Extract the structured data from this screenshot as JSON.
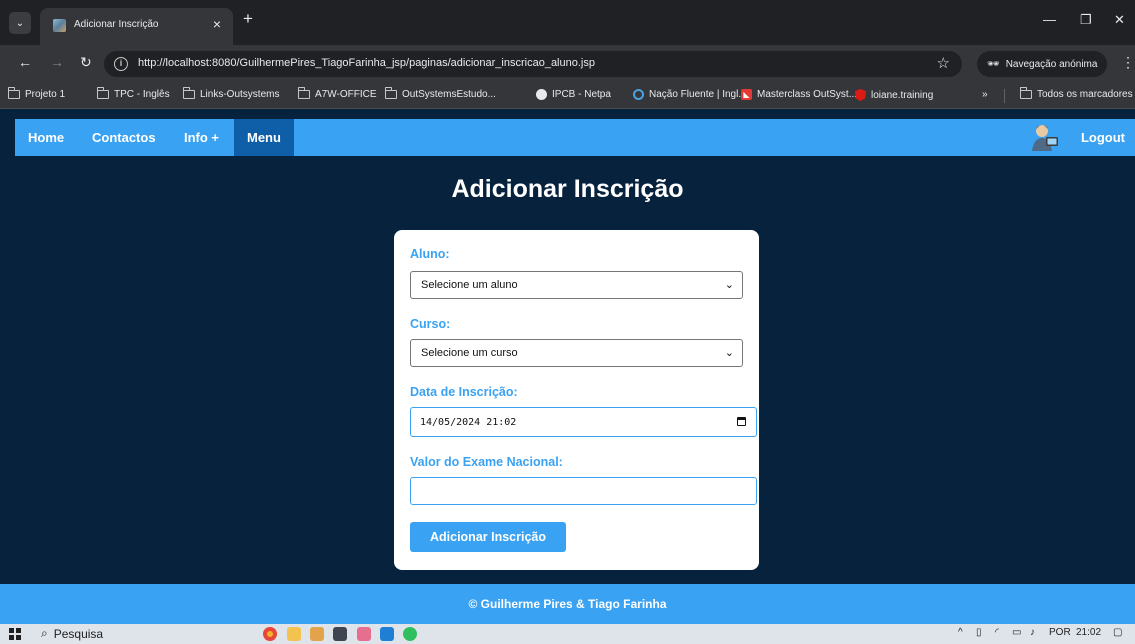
{
  "browser": {
    "tab_title": "Adicionar Inscrição",
    "url": "http://localhost:8080/GuilhermePires_TiagoFarinha_jsp/paginas/adicionar_inscricao_aluno.jsp",
    "incognito_label": "Navegação anónima",
    "bookmarks": [
      {
        "label": "Projeto 1",
        "icon": "folder-icon"
      },
      {
        "label": "TPC - Inglês",
        "icon": "folder-icon"
      },
      {
        "label": "Links-Outsystems",
        "icon": "folder-icon"
      },
      {
        "label": "A7W-OFFICE",
        "icon": "folder-icon"
      },
      {
        "label": "OutSystemsEstudo...",
        "icon": "folder-icon"
      },
      {
        "label": "IPCB - Netpa",
        "icon": "globe-icon"
      },
      {
        "label": "Nação Fluente | Ingl...",
        "icon": "ring-icon"
      },
      {
        "label": "Masterclass OutSyst...",
        "icon": "red-icon"
      },
      {
        "label": "loiane.training",
        "icon": "angular-icon"
      }
    ],
    "all_bookmarks_label": "Todos os marcadores"
  },
  "navbar": {
    "items": [
      {
        "label": "Home"
      },
      {
        "label": "Contactos"
      },
      {
        "label": "Info +"
      },
      {
        "label": "Menu"
      }
    ],
    "active": "Menu",
    "logout_label": "Logout"
  },
  "page": {
    "title": "Adicionar Inscrição"
  },
  "form": {
    "aluno_label": "Aluno:",
    "aluno_selected": "Selecione um aluno",
    "curso_label": "Curso:",
    "curso_selected": "Selecione um curso",
    "data_label": "Data de Inscrição:",
    "data_value": "14/05/2024 21:02",
    "exame_label": "Valor do Exame Nacional:",
    "exame_value": "",
    "submit_label": "Adicionar Inscrição"
  },
  "footer": {
    "text": "© Guilherme Pires & Tiago Farinha"
  },
  "taskbar": {
    "search_label": "Pesquisa",
    "language": "POR",
    "time": "21:02"
  },
  "colors": {
    "accent": "#3aa2f2",
    "active_nav": "#0e5fa8",
    "background": "#07223d"
  }
}
